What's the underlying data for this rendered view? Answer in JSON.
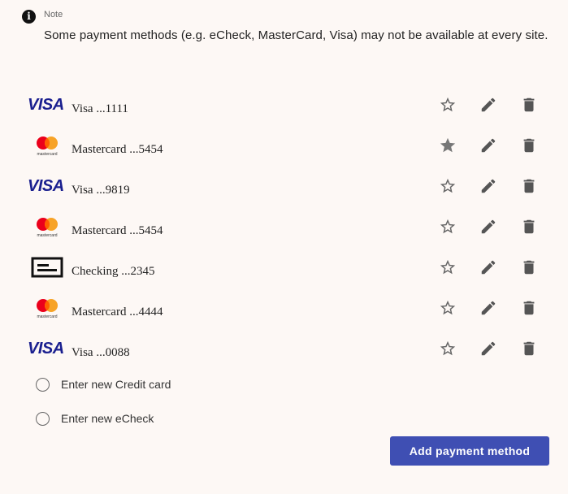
{
  "note": {
    "icon": "info-icon",
    "label": "Note",
    "text": "Some payment methods (e.g. eCheck, MasterCard, Visa) may not be available at every site."
  },
  "methods": [
    {
      "brand": "visa",
      "brand_text": "VISA",
      "label": "Visa ...1111",
      "favorite": false
    },
    {
      "brand": "mastercard",
      "brand_text": "mastercard",
      "label": "Mastercard ...5454",
      "favorite": true
    },
    {
      "brand": "visa",
      "brand_text": "VISA",
      "label": "Visa ...9819",
      "favorite": false
    },
    {
      "brand": "mastercard",
      "brand_text": "mastercard",
      "label": "Mastercard ...5454",
      "favorite": false
    },
    {
      "brand": "check",
      "brand_text": "",
      "label": "Checking ...2345",
      "favorite": false
    },
    {
      "brand": "mastercard",
      "brand_text": "mastercard",
      "label": "Mastercard ...4444",
      "favorite": false
    },
    {
      "brand": "visa",
      "brand_text": "VISA",
      "label": "Visa ...0088",
      "favorite": false
    }
  ],
  "action_icons": {
    "favorite": "star-icon",
    "edit": "pencil-icon",
    "delete": "trash-icon"
  },
  "new_options": [
    {
      "label": "Enter new Credit card",
      "selected": false
    },
    {
      "label": "Enter new eCheck",
      "selected": false
    }
  ],
  "add_button": {
    "label": "Add payment method"
  },
  "colors": {
    "background": "#fdf8f5",
    "visa_blue": "#1a1f8f",
    "mc_red": "#eb001b",
    "mc_orange": "#f79e1b",
    "icon_gray": "#666666",
    "button_blue": "#3f4fb3"
  }
}
